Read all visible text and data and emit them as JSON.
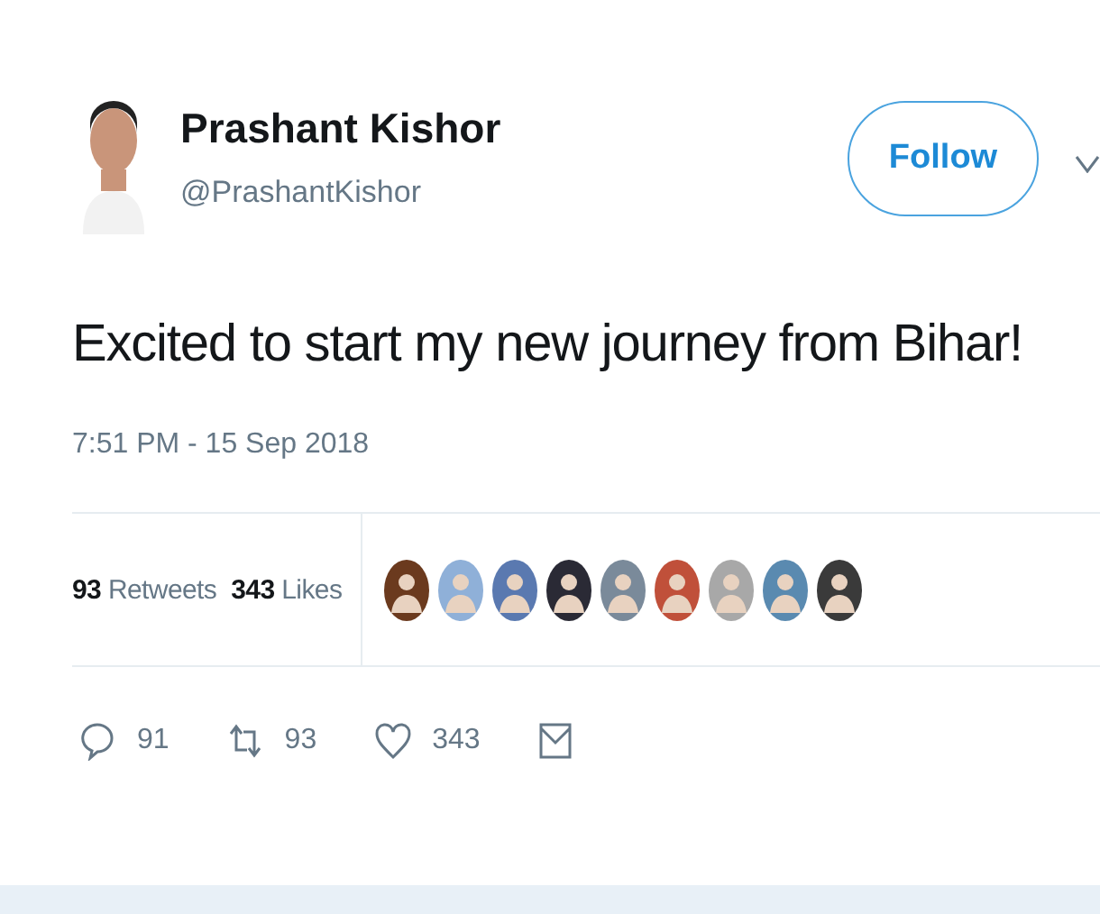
{
  "author": {
    "name": "Prashant Kishor",
    "handle": "@PrashantKishor"
  },
  "follow_button": {
    "label": "Follow"
  },
  "tweet": {
    "text": "Excited to start my new journey from Bihar!",
    "time": "7:51 PM - 15 Sep 2018"
  },
  "stats": [
    {
      "count": "93",
      "label": "Retweets"
    },
    {
      "count": "343",
      "label": "Likes"
    }
  ],
  "likers": [
    {
      "color": "#6b3a1e"
    },
    {
      "color": "#8fb0d8"
    },
    {
      "color": "#5a79b0"
    },
    {
      "color": "#2a2a35"
    },
    {
      "color": "#7a8a9a"
    },
    {
      "color": "#c0503a"
    },
    {
      "color": "#a8a8a8"
    },
    {
      "color": "#5a8ab0"
    },
    {
      "color": "#3a3a3a"
    }
  ],
  "actions": [
    {
      "kind": "reply",
      "count": "91"
    },
    {
      "kind": "retweet",
      "count": "93"
    },
    {
      "kind": "like",
      "count": "343"
    },
    {
      "kind": "message"
    }
  ]
}
